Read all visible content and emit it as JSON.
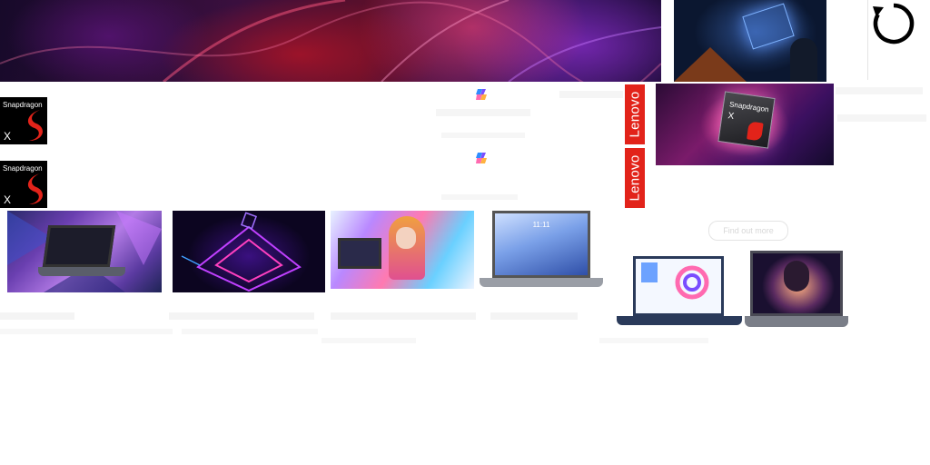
{
  "hero_banner": {
    "colors": {
      "deep": "#170a2a",
      "red": "#aa1428",
      "magenta": "#dc3c6e",
      "purple": "#7828b4"
    }
  },
  "snapdragon_badges": [
    {
      "brand": "Snapdragon",
      "model": "X"
    },
    {
      "brand": "Snapdragon",
      "model": "X"
    }
  ],
  "chip_image": {
    "brand": "Snapdragon",
    "model": "X"
  },
  "lenovo_logos": [
    {
      "text": "Lenovo",
      "color": "#e2231a"
    },
    {
      "text": "Lenovo",
      "color": "#e2231a"
    }
  ],
  "promo": {
    "find_out_more": "Find out more"
  },
  "laptop_screen": {
    "time": "11:11"
  },
  "icons": {
    "reload": "reload-icon",
    "copilot": "copilot-icon"
  }
}
